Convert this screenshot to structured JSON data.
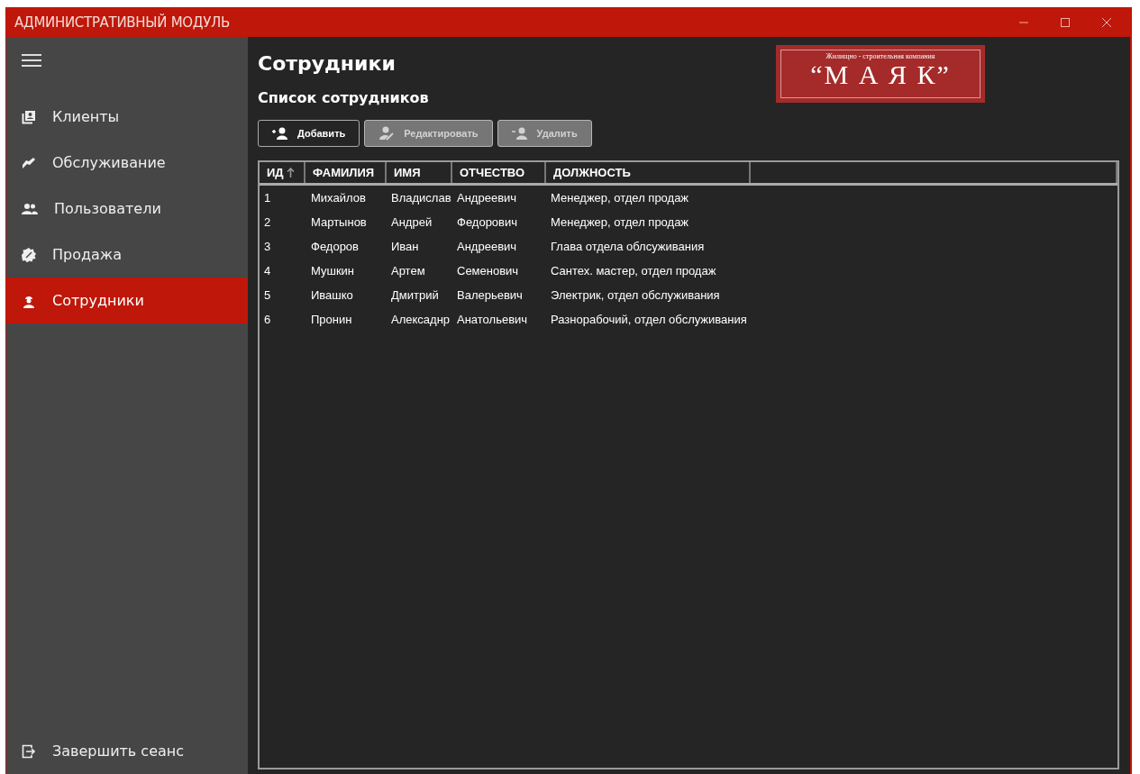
{
  "window": {
    "title": "АДМИНИСТРАТИВНЫЙ МОДУЛЬ"
  },
  "sidebar": {
    "items": [
      {
        "label": "Клиенты",
        "kind": "clients",
        "selected": false
      },
      {
        "label": "Обслуживание",
        "kind": "service",
        "selected": false
      },
      {
        "label": "Пользователи",
        "kind": "users",
        "selected": false
      },
      {
        "label": "Продажа",
        "kind": "sale",
        "selected": false
      },
      {
        "label": "Сотрудники",
        "kind": "staff",
        "selected": true
      }
    ],
    "logout": "Завершить сеанс"
  },
  "page": {
    "title": "Сотрудники",
    "subtitle": "Список сотрудников"
  },
  "logo": {
    "tagline": "Жилищно - строительная компания",
    "name": "“М А Я К”"
  },
  "toolbar": [
    {
      "label": "Добавить",
      "kind": "add",
      "disabled": false
    },
    {
      "label": "Редактировать",
      "kind": "edit",
      "disabled": true
    },
    {
      "label": "Удалить",
      "kind": "remove",
      "disabled": true
    }
  ],
  "table": {
    "columns": [
      {
        "label": "ИД",
        "sorted": true
      },
      {
        "label": "ФАМИЛИЯ",
        "sorted": false
      },
      {
        "label": "ИМЯ",
        "sorted": false
      },
      {
        "label": "ОТЧЕСТВО",
        "sorted": false
      },
      {
        "label": "ДОЛЖНОСТЬ",
        "sorted": false
      }
    ],
    "rows": [
      [
        "1",
        "Михайлов",
        "Владислав",
        "Андреевич",
        "Менеджер, отдел продаж"
      ],
      [
        "2",
        "Мартынов",
        "Андрей",
        "Федорович",
        "Менеджер, отдел продаж"
      ],
      [
        "3",
        "Федоров",
        "Иван",
        "Андреевич",
        "Глава отдела облсуживания"
      ],
      [
        "4",
        "Мушкин",
        "Артем",
        "Семенович",
        "Сантех. мастер, отдел продаж"
      ],
      [
        "5",
        "Ивашко",
        "Дмитрий",
        "Валерьевич",
        "Электрик, отдел обслуживания"
      ],
      [
        "6",
        "Пронин",
        "Алексаднр",
        "Анатольевич",
        "Разнорабочий, отдел обслуживания"
      ]
    ]
  }
}
